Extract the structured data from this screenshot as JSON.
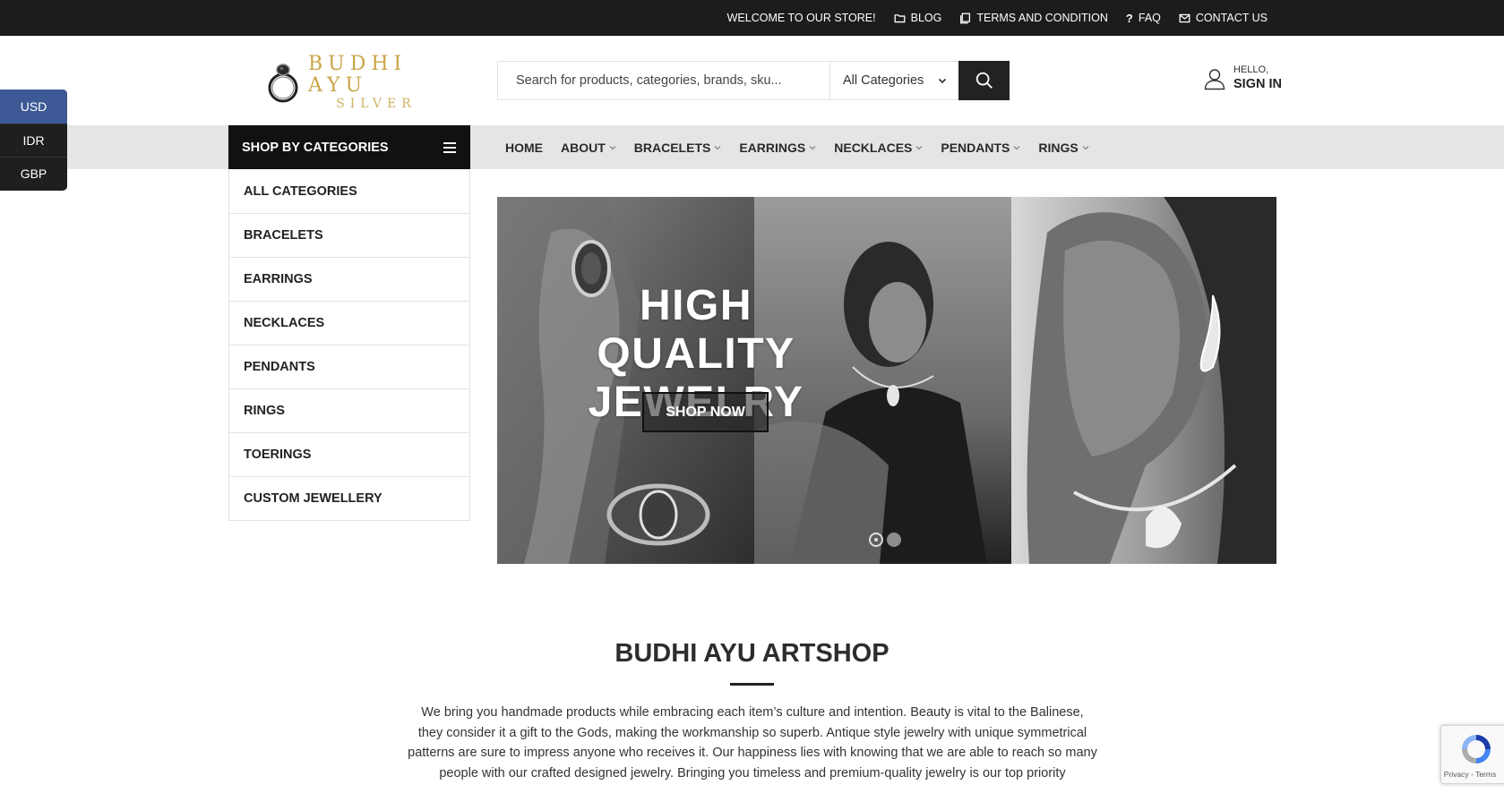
{
  "topbar": {
    "welcome": "WELCOME TO OUR STORE!",
    "blog": "BLOG",
    "terms": "TERMS AND CONDITION",
    "faq": "FAQ",
    "contact": "CONTACT US"
  },
  "logo": {
    "main": "BUDHI AYU",
    "sub": "SILVER"
  },
  "search": {
    "placeholder": "Search for products, categories, brands, sku...",
    "category": "All Categories"
  },
  "account": {
    "hello": "HELLO,",
    "signin": "SIGN IN"
  },
  "currency": [
    "USD",
    "IDR",
    "GBP"
  ],
  "shop_by_categories": "SHOP BY CATEGORIES",
  "nav": [
    "HOME",
    "ABOUT",
    "BRACELETS",
    "EARRINGS",
    "NECKLACES",
    "PENDANTS",
    "RINGS"
  ],
  "categories": [
    "ALL CATEGORIES",
    "BRACELETS",
    "EARRINGS",
    "NECKLACES",
    "PENDANTS",
    "RINGS",
    "TOERINGS",
    "CUSTOM JEWELLERY"
  ],
  "hero": {
    "title_line1": "HIGH QUALITY",
    "title_line2": "JEWELRY",
    "button": "SHOP NOW",
    "slide_count": 2,
    "active_slide": 1
  },
  "about": {
    "title": "BUDHI AYU ARTSHOP",
    "text": "We bring you handmade products while embracing each item’s culture and intention. Beauty is vital to the Balinese, they consider it a gift to the Gods, making the workmanship so superb. Antique style jewelry with unique symmetrical patterns are sure to impress anyone who receives it. Our happiness lies with knowing that we are able to reach so many people with our crafted designed jewelry. Bringing you timeless and premium-quality jewelry is our top priority"
  },
  "recaptcha": {
    "links": "Privacy - Terms"
  },
  "colors": {
    "topbar_bg": "#1c1c1c",
    "nav_bg": "#e5e5e5",
    "logo_gold": "#c9a548",
    "currency_active": "#3d5a96"
  }
}
